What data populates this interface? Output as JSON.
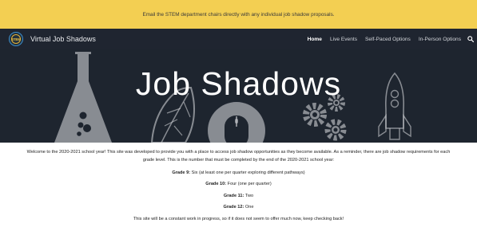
{
  "announcement": "Email the STEM department chairs directly with any individual job shadow proposals.",
  "nav": {
    "logo_text": "STEM",
    "site_title": "Virtual Job Shadows",
    "links": [
      {
        "label": "Home",
        "active": true
      },
      {
        "label": "Live Events",
        "active": false
      },
      {
        "label": "Self-Paced Options",
        "active": false
      },
      {
        "label": "In-Person Options",
        "active": false
      }
    ],
    "search_icon": "search-icon"
  },
  "hero": {
    "title": "Job Shadows",
    "icons": [
      "flask-icon",
      "leaf-icon",
      "mouse-icon",
      "gears-icon",
      "rocket-icon"
    ]
  },
  "content": {
    "intro": "Welcome to the 2020-2021 school year! This site was developed to provide you with a place to access job shadow opportunities as they become available.  As a reminder, there are job shadow requirements for each grade level. This is the number that must be completed by the end of the 2020-2021 school year:",
    "grades": [
      {
        "label": "Grade 9:",
        "value": " Six (at least one per quarter exploring different pathways)"
      },
      {
        "label": "Grade 10:",
        "value": " Four (one per quarter)"
      },
      {
        "label": "Grade 11:",
        "value": " Two"
      },
      {
        "label": "Grade 12:",
        "value": " One"
      }
    ],
    "footer_note": "This site will be a constant work in progress, so if it does not seem to offer much now, keep checking back!"
  },
  "colors": {
    "announcement_bg": "#f3cf52",
    "nav_bg": "#1f2530",
    "hero_bg": "#1e252f"
  }
}
